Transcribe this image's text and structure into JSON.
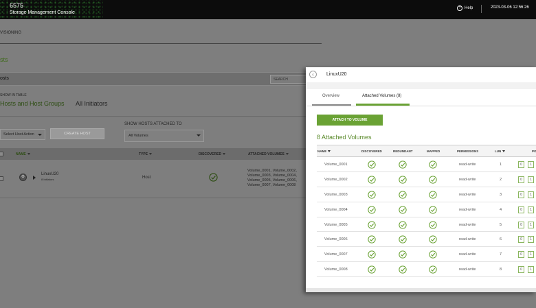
{
  "topbar": {
    "model": "6575",
    "app_name": "Storage Management Console",
    "help": "Help",
    "datetime": "2023-03-06 12:56:26"
  },
  "page": {
    "provisioning": "VISIONING",
    "hosts_title": "sts",
    "hosts_bar_label": "osts",
    "search_placeholder": "SEARCH",
    "show_in_table": "SHOW IN TABLE",
    "tabs": [
      "Hosts and Host Groups",
      "All Initiators"
    ],
    "tab_hosts_visible": "Hosts and Host Groups",
    "show_hosts_attached": "SHOW HOSTS ATTACHED TO",
    "host_action": "Select Host Action",
    "create_host": "CREATE HOST",
    "volume_filter": "All Volumes",
    "columns": {
      "name": "NAME",
      "type": "TYPE",
      "discovered": "DISCOVERED",
      "attached": "ATTACHED VOLUMES"
    },
    "host_row": {
      "name": "LinuxU20",
      "initiators": "8 Initiators",
      "type": "Host",
      "volumes_line1": "Volume_0001, Volume_0002,",
      "volumes_line2": "Volume_0003, Volume_0004,",
      "volumes_line3": "Volume_0005, Volume_0006,",
      "volumes_line4": "Volume_0007, Volume_0008"
    }
  },
  "panel": {
    "title": "LinuxU20",
    "tabs": {
      "overview": "Overview",
      "attached": "Attached Volumes (8)"
    },
    "attach_button": "ATTACH TO VOLUME",
    "attached_title": "8 Attached Volumes",
    "columns": {
      "name": "NAME",
      "discovered": "DISCOVERED",
      "redundant": "REDUNDANT",
      "mapped": "MAPPED",
      "permissions": "PERMISSIONS",
      "lun": "LUN",
      "ports": "PO"
    },
    "rows": [
      {
        "name": "Volume_0001",
        "permissions": "read-write",
        "lun": "1",
        "p0": "0",
        "p1": "1"
      },
      {
        "name": "Volume_0002",
        "permissions": "read-write",
        "lun": "2",
        "p0": "0",
        "p1": "1"
      },
      {
        "name": "Volume_0003",
        "permissions": "read-write",
        "lun": "3",
        "p0": "0",
        "p1": "1"
      },
      {
        "name": "Volume_0004",
        "permissions": "read-write",
        "lun": "4",
        "p0": "0",
        "p1": "1"
      },
      {
        "name": "Volume_0005",
        "permissions": "read-write",
        "lun": "5",
        "p0": "0",
        "p1": "1"
      },
      {
        "name": "Volume_0006",
        "permissions": "read-write",
        "lun": "6",
        "p0": "0",
        "p1": "1"
      },
      {
        "name": "Volume_0007",
        "permissions": "read-write",
        "lun": "7",
        "p0": "0",
        "p1": "1"
      },
      {
        "name": "Volume_0008",
        "permissions": "read-write",
        "lun": "8",
        "p0": "0",
        "p1": "1"
      }
    ]
  },
  "colors": {
    "accent": "#6aa234",
    "topbar": "#0c0c0c",
    "overlay": "#7e7e7e"
  },
  "icons": {
    "check": "check-circle-icon",
    "back": "chevron-left-icon",
    "help": "help-circle-icon"
  }
}
